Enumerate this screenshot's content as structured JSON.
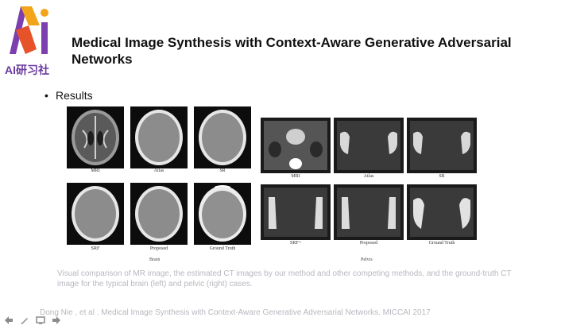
{
  "logo": {
    "text": "AI研习社"
  },
  "slide": {
    "title": "Medical Image Synthesis with Context-Aware Generative Adversarial Networks",
    "bullet": "Results"
  },
  "figure": {
    "brain_labels": [
      "MRI",
      "Atlas",
      "SR",
      "SRF",
      "Proposed",
      "Ground Truth"
    ],
    "brain_caption": "Brain",
    "pelvis_labels": [
      "MRI",
      "Atlas",
      "SR",
      "SRF+",
      "Proposed",
      "Ground Truth"
    ],
    "pelvis_caption": "Pelvis"
  },
  "caption": "Visual comparison of MR image, the estimated CT images by our method and other competing methods, and the ground-truth CT image for the typical brain (left) and pelvic (right) cases.",
  "reference": "Dong Nie , et al . Medical Image Synthesis with Context-Aware Generative Adversarial Networks. MICCAI 2017",
  "toolbar": [
    "back-arrow-icon",
    "pen-icon",
    "screen-icon",
    "forward-arrow-icon"
  ]
}
